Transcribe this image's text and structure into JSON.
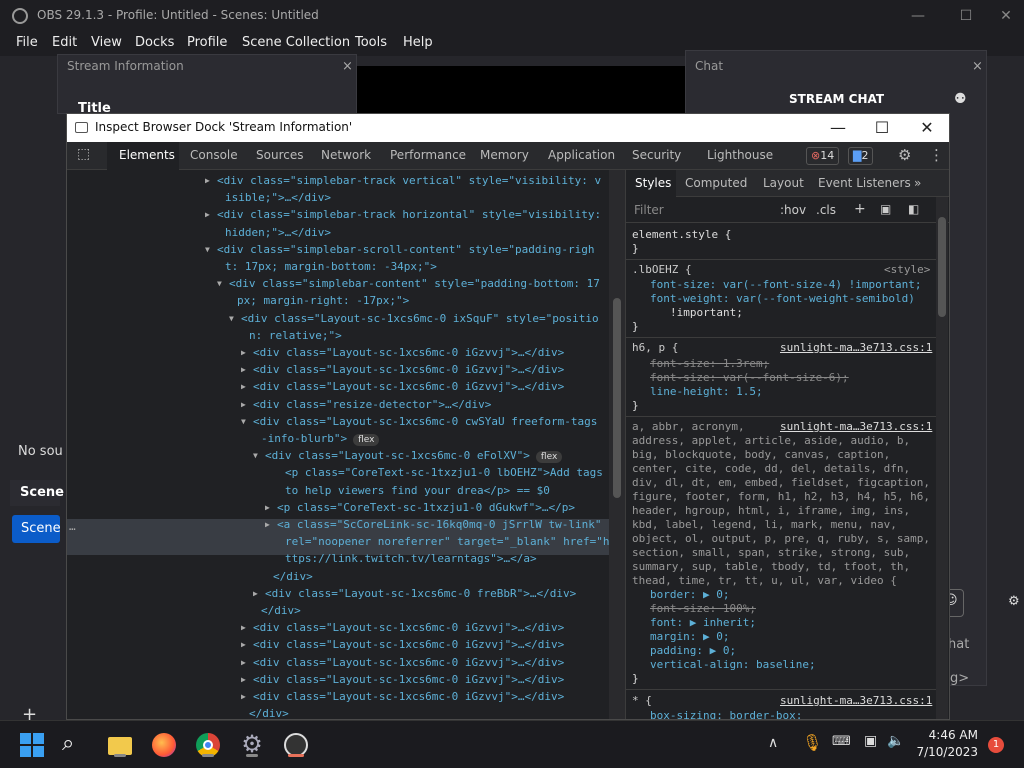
{
  "window": {
    "title": "OBS 29.1.3 - Profile: Untitled - Scenes: Untitled"
  },
  "menu": [
    "File",
    "Edit",
    "View",
    "Docks",
    "Profile",
    "Scene Collection",
    "Tools",
    "Help"
  ],
  "docks": {
    "stream_info": {
      "title": "Stream Information",
      "close": "×",
      "field": "Title"
    },
    "chat": {
      "title": "Chat",
      "close": "×",
      "header": "STREAM CHAT"
    },
    "no_source": "No sou",
    "scenes_header": "Scene",
    "scene_item": "Scene",
    "add": "+",
    "chat_side_label": "hat",
    "chat_side_label2": "g>"
  },
  "devtools": {
    "title": "Inspect Browser Dock 'Stream Information'",
    "tabs": [
      "Elements",
      "Console",
      "Sources",
      "Network",
      "Performance",
      "Memory",
      "Application",
      "Security",
      "Lighthouse"
    ],
    "error_count": "14",
    "message_count": "2",
    "elements_lines": [
      {
        "t": "▶",
        "h": "<div class=\"simplebar-track vertical\" style=\"visibility: v"
      },
      {
        "t": "",
        "h": "isible;\">…</div>"
      },
      {
        "t": "▶",
        "h": "<div class=\"simplebar-track horizontal\" style=\"visibility:"
      },
      {
        "t": "",
        "h": "hidden;\">…</div>"
      },
      {
        "t": "▼",
        "h": "<div class=\"simplebar-scroll-content\" style=\"padding-righ"
      },
      {
        "t": "",
        "h": "t: 17px; margin-bottom: -34px;\">"
      },
      {
        "t": "▼",
        "h": "<div class=\"simplebar-content\" style=\"padding-bottom: 17"
      },
      {
        "t": "",
        "h": "px; margin-right: -17px;\">"
      },
      {
        "t": "▼",
        "h": "<div class=\"Layout-sc-1xcs6mc-0 ixSquF\" style=\"positio"
      },
      {
        "t": "",
        "h": "n: relative;\">"
      },
      {
        "t": "▶",
        "h": "<div class=\"Layout-sc-1xcs6mc-0 iGzvvj\">…</div>"
      },
      {
        "t": "▶",
        "h": "<div class=\"Layout-sc-1xcs6mc-0 iGzvvj\">…</div>"
      },
      {
        "t": "▶",
        "h": "<div class=\"Layout-sc-1xcs6mc-0 iGzvvj\">…</div>"
      },
      {
        "t": "▶",
        "h": "<div class=\"resize-detector\">…</div>"
      },
      {
        "t": "▼",
        "h": "<div class=\"Layout-sc-1xcs6mc-0 cwSYaU freeform-tags"
      },
      {
        "t": "",
        "h": "-info-blurb\">",
        "pill": "flex"
      },
      {
        "t": "▼",
        "h": "<div class=\"Layout-sc-1xcs6mc-0 eFolXV\">",
        "pill": "flex"
      },
      {
        "t": "",
        "h": "<p class=\"CoreText-sc-1txzju1-0 lbOEHZ\">Add tags"
      },
      {
        "t": "",
        "h": "to help viewers find your drea</p> == $0"
      },
      {
        "t": "▶",
        "h": "<p class=\"CoreText-sc-1txzju1-0 dGukwf\">…</p>"
      },
      {
        "t": "▶",
        "h": "<a class=\"ScCoreLink-sc-16kq0mq-0 jSrrlW tw-link\""
      },
      {
        "t": "",
        "h": "rel=\"noopener noreferrer\" target=\"_blank\" href=\"h"
      },
      {
        "t": "",
        "h": "ttps://link.twitch.tv/learntags\">…</a>"
      },
      {
        "t": "",
        "h": "</div>"
      },
      {
        "t": "▶",
        "h": "<div class=\"Layout-sc-1xcs6mc-0 freBbR\">…</div>"
      },
      {
        "t": "",
        "h": "</div>"
      },
      {
        "t": "▶",
        "h": "<div class=\"Layout-sc-1xcs6mc-0 iGzvvj\">…</div>"
      },
      {
        "t": "▶",
        "h": "<div class=\"Layout-sc-1xcs6mc-0 iGzvvj\">…</div>"
      },
      {
        "t": "▶",
        "h": "<div class=\"Layout-sc-1xcs6mc-0 iGzvvj\">…</div>"
      },
      {
        "t": "▶",
        "h": "<div class=\"Layout-sc-1xcs6mc-0 iGzvvj\">…</div>"
      },
      {
        "t": "▶",
        "h": "<div class=\"Layout-sc-1xcs6mc-0 iGzvvj\">…</div>"
      },
      {
        "t": "",
        "h": "</div>"
      }
    ],
    "styles_tabs": [
      "Styles",
      "Computed",
      "Layout",
      "Event Listeners",
      "»"
    ],
    "filter_placeholder": "Filter",
    "hov": ":hov",
    "cls": ".cls",
    "rules": {
      "element_style": "element.style {",
      "close": "}",
      "r1_sel": ".lbOEHZ {",
      "r1_src": "<style>",
      "r1_p1": "font-size: var(--font-size-4) !important;",
      "r1_p2": "font-weight: var(--font-weight-semibold)",
      "r1_p2b": "!important;",
      "r2_sel": "h6, p {",
      "r2_src": "sunlight-ma…3e713.css:1",
      "r2_p1": "font-size: 1.3rem;",
      "r2_p2": "font-size: var(--font-size-6);",
      "r2_p3": "line-height: 1.5;",
      "r3_src": "sunlight-ma…3e713.css:1",
      "r3_sel": "a, abbr, acronym,\naddress, applet, article, aside, audio, b,\nbig, blockquote, body, canvas, caption,\ncenter, cite, code, dd, del, details, dfn,\ndiv, dl, dt, em, embed, fieldset, figcaption,\nfigure, footer, form, h1, h2, h3, h4, h5, h6,\nheader, hgroup, html, i, iframe, img, ins,\nkbd, label, legend, li, mark, menu, nav,\nobject, ol, output, p, pre, q, ruby, s, samp,\nsection, small, span, strike, strong, sub,\nsummary, sup, table, tbody, td, tfoot, th,\nthead, time, tr, tt, u, ul, var, video {",
      "r3_p1": "border: ▶ 0;",
      "r3_p2": "font-size: 100%;",
      "r3_p3": "font: ▶ inherit;",
      "r3_p4": "margin: ▶ 0;",
      "r3_p5": "padding: ▶ 0;",
      "r3_p6": "vertical-align: baseline;",
      "r4_sel": "* {",
      "r4_src": "sunlight-ma…3e713.css:1",
      "r4_p1": "box-sizing: border-box;"
    }
  },
  "taskbar": {
    "time": "4:46 AM",
    "date": "7/10/2023",
    "notif": "1"
  },
  "colors": {
    "accent": "#0078d4",
    "devtools_bg": "#202124",
    "obs_bg": "#26262b"
  }
}
